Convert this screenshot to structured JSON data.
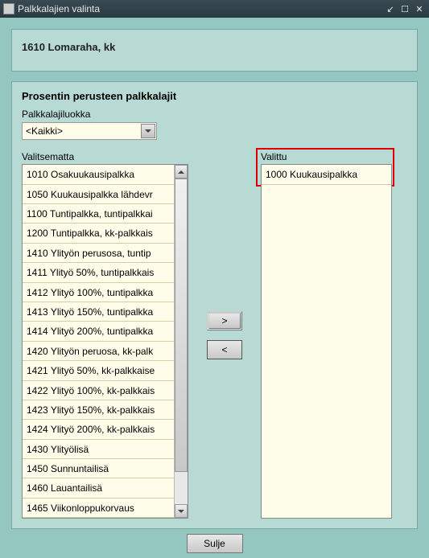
{
  "window": {
    "title": "Palkkalajien valinta"
  },
  "header": {
    "title": "1610 Lomaraha, kk"
  },
  "section": {
    "title": "Prosentin perusteen palkkalajit",
    "category_label": "Palkkalajiluokka",
    "category_value": "<Kaikki>",
    "left_label": "Valitsematta",
    "right_label": "Valittu"
  },
  "left_items": [
    "1010 Osakuukausipalkka",
    "1050 Kuukausipalkka lähdevr",
    "1100 Tuntipalkka, tuntipalkkai",
    "1200 Tuntipalkka, kk-palkkais",
    "1410 Ylityön perusosa, tuntip",
    "1411 Ylityö 50%, tuntipalkkais",
    "1412 Ylityö 100%, tuntipalkka",
    "1413 Ylityö 150%, tuntipalkka",
    "1414 Ylityö 200%, tuntipalkka",
    "1420 Ylityön peruosa, kk-palk",
    "1421 Ylityö 50%, kk-palkkaise",
    "1422 Ylityö 100%, kk-palkkais",
    "1423 Ylityö 150%, kk-palkkais",
    "1424 Ylityö 200%, kk-palkkais",
    "1430 Ylityölisä",
    "1450 Sunnuntailisä",
    "1460 Lauantailisä",
    "1465 Viikonloppukorvaus"
  ],
  "right_items": [
    "1000 Kuukausipalkka"
  ],
  "buttons": {
    "move_right": ">",
    "move_left": "<",
    "close": "Sulje"
  }
}
